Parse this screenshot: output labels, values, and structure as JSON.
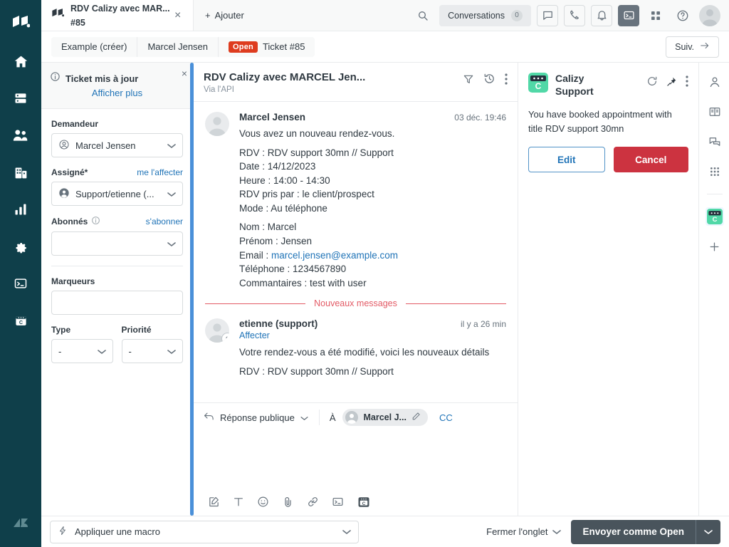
{
  "tab": {
    "title": "RDV Calizy avec MAR...",
    "number": "#85",
    "close": "×",
    "add_label": "Ajouter",
    "add_plus": "+"
  },
  "topbar": {
    "conversations_label": "Conversations",
    "conversations_count": "0"
  },
  "breadcrumb": {
    "items": [
      "Example (créer)",
      "Marcel Jensen"
    ],
    "status_badge": "Open",
    "ticket_label": "Ticket #85",
    "next_label": "Suiv."
  },
  "properties": {
    "notice_title": "Ticket mis à jour",
    "notice_link": "Afficher plus",
    "notice_close": "×",
    "requester_label": "Demandeur",
    "requester_value": "Marcel Jensen",
    "assignee_label": "Assigné*",
    "assignee_link": "me l'affecter",
    "assignee_value": "Support/etienne (...",
    "followers_label": "Abonnés",
    "followers_link": "s'abonner",
    "followers_value": "",
    "tags_label": "Marqueurs",
    "tags_value": "",
    "type_label": "Type",
    "type_value": "-",
    "priority_label": "Priorité",
    "priority_value": "-"
  },
  "conversation": {
    "title": "RDV Calizy avec MARCEL Jen...",
    "via": "Via l'API",
    "new_messages_label": "Nouveaux messages",
    "messages": [
      {
        "author": "Marcel Jensen",
        "time": "03 déc. 19:46",
        "intro": "Vous avez un nouveau rendez-vous.",
        "block1": "RDV : RDV support 30mn // Support\nDate : 14/12/2023\nHeure : 14:00 - 14:30\nRDV pris par : le client/prospect\nMode : Au téléphone",
        "block2_pre": "Nom : Marcel\nPrénom : Jensen\nEmail : ",
        "email": "marcel.jensen@example.com",
        "block2_post": "\nTéléphone : 1234567890\nCommantaires : test with user"
      },
      {
        "author": "etienne (support)",
        "link": "Affecter",
        "time": "il y a 26 min",
        "intro": "Votre rendez-vous a été modifié, voici les nouveaux détails",
        "block1": "RDV : RDV support 30mn // Support"
      }
    ]
  },
  "composer": {
    "mode_label": "Réponse publique",
    "to_label": "À",
    "recipient": "Marcel J...",
    "cc_label": "CC"
  },
  "app_panel": {
    "name_line1": "Calizy",
    "name_line2": "Support",
    "logo_letter": "C",
    "message": "You have booked appointment with title RDV support 30mn",
    "edit_label": "Edit",
    "cancel_label": "Cancel"
  },
  "bottom": {
    "macro_placeholder": "Appliquer une macro",
    "close_tab_label": "Fermer l'onglet",
    "submit_label": "Envoyer comme Open"
  },
  "colors": {
    "rail_bg": "#0f3f4a",
    "link": "#1f73b7",
    "open_badge": "#de3c1f",
    "cancel": "#cc3340",
    "submit": "#49545c",
    "new_messages": "#e35b66",
    "app_accent": "#51d8a7"
  }
}
